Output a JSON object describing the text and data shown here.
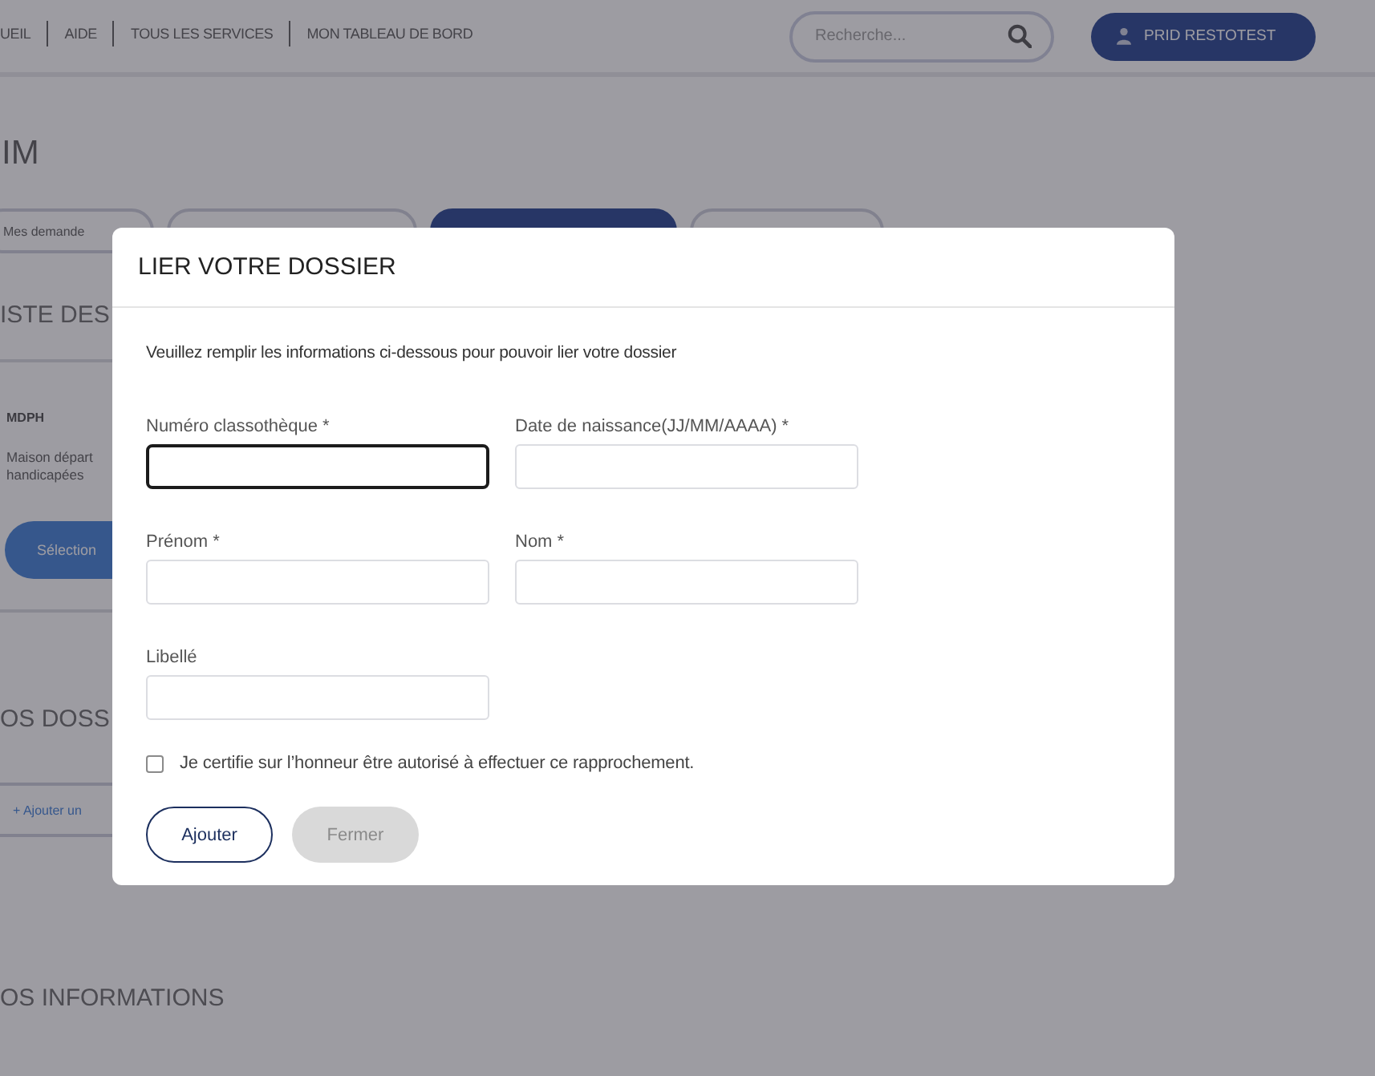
{
  "header": {
    "nav_links": [
      "UEIL",
      "AIDE",
      "TOUS LES SERVICES",
      "MON TABLEAU DE BORD"
    ],
    "search": {
      "placeholder": "Recherche..."
    },
    "user_button": "PRID RESTOTEST"
  },
  "page": {
    "title": "IM",
    "tabs": [
      {
        "label": "Mes demande",
        "selected": false
      },
      {
        "selected": false
      },
      {
        "selected": true
      },
      {
        "selected": false
      }
    ],
    "list_heading": "ISTE DES",
    "card": {
      "title": "MDPH",
      "description": [
        "Maison départ",
        "handicapées"
      ],
      "button": "Sélection"
    },
    "dossiers_heading": "OS DOSS",
    "add_button": "+ Ajouter un",
    "informations_heading": "OS INFORMATIONS"
  },
  "modal": {
    "title": "LIER VOTRE DOSSIER",
    "intro": "Veuillez remplir les informations ci-dessous pour pouvoir lier votre dossier",
    "fields": [
      {
        "label": "Numéro classothèque *",
        "focused": true
      },
      {
        "label": "Date de naissance(JJ/MM/AAAA) *",
        "focused": false
      },
      {
        "label": "Prénom *",
        "focused": false
      },
      {
        "label": "Nom *",
        "focused": false
      },
      {
        "label": "Libellé",
        "focused": false
      }
    ],
    "certify": {
      "label": "Je certifie sur l’honneur être autorisé à effectuer ce rapprochement.",
      "checked": false
    },
    "buttons": [
      {
        "label": "Ajouter",
        "kind": "primary"
      },
      {
        "label": "Fermer",
        "kind": "secondary"
      }
    ]
  }
}
